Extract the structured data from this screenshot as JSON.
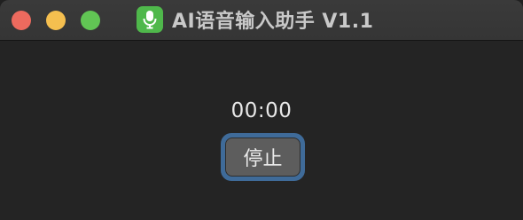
{
  "window": {
    "title": "AI语音输入助手 V1.1",
    "app_icon": "microphone-icon"
  },
  "traffic_lights": {
    "close_color": "#ed6a5e",
    "minimize_color": "#f5bf4f",
    "maximize_color": "#61c554"
  },
  "main": {
    "timer": "00:00",
    "stop_label": "停止"
  },
  "colors": {
    "background": "#242424",
    "focus_ring": "#3f6b99",
    "button": "#5d5d5d",
    "app_icon_bg": "#4fb84b"
  }
}
